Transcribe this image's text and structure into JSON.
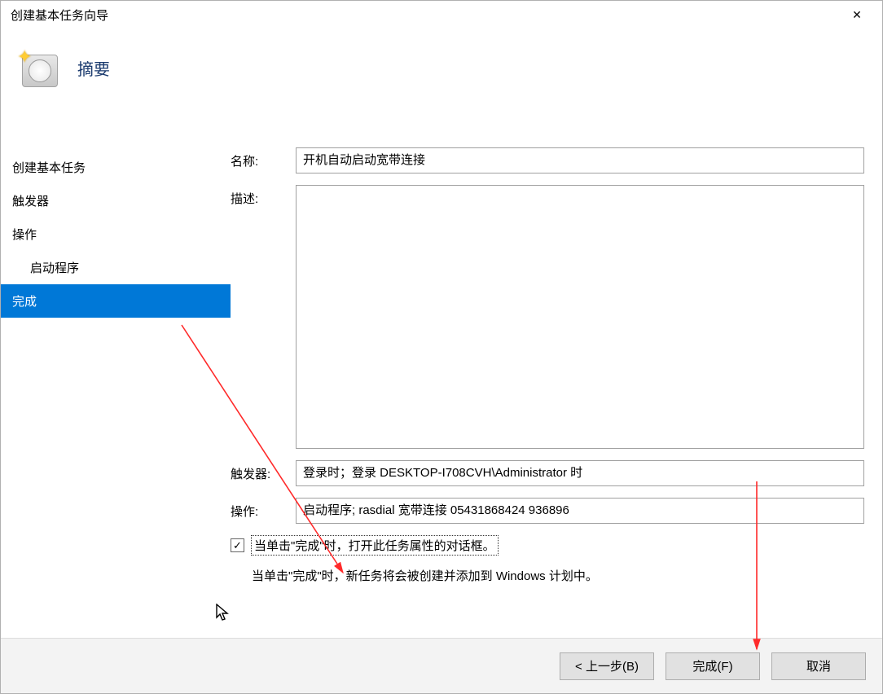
{
  "window": {
    "title": "创建基本任务向导"
  },
  "header": {
    "title": "摘要"
  },
  "sidebar": {
    "items": [
      {
        "label": "创建基本任务",
        "sub": false,
        "selected": false
      },
      {
        "label": "触发器",
        "sub": false,
        "selected": false
      },
      {
        "label": "操作",
        "sub": false,
        "selected": false
      },
      {
        "label": "启动程序",
        "sub": true,
        "selected": false
      },
      {
        "label": "完成",
        "sub": false,
        "selected": true
      }
    ]
  },
  "form": {
    "name_label": "名称:",
    "name_value": "开机自动启动宽带连接",
    "desc_label": "描述:",
    "desc_value": "",
    "trigger_label": "触发器:",
    "trigger_value": "登录时；登录 DESKTOP-I708CVH\\Administrator 时",
    "action_label": "操作:",
    "action_value": "启动程序; rasdial 宽带连接 05431868424 936896",
    "checkbox_label": "当单击\"完成\"时，打开此任务属性的对话框。",
    "note_text": "当单击\"完成\"时，新任务将会被创建并添加到 Windows 计划中。"
  },
  "buttons": {
    "back": "< 上一步(B)",
    "finish": "完成(F)",
    "cancel": "取消"
  }
}
